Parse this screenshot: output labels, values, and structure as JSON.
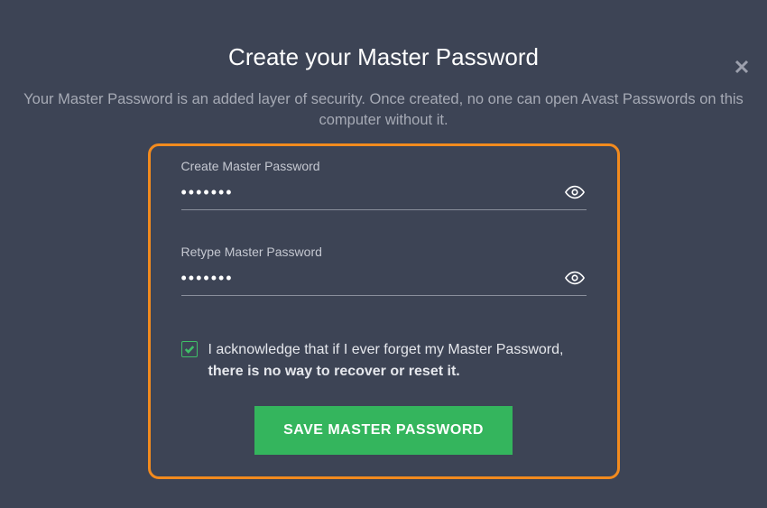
{
  "title": "Create your Master Password",
  "subtitle": "Your Master Password is an added layer of security. Once created, no one can open Avast Passwords on this computer without it.",
  "fields": {
    "create": {
      "label": "Create Master Password",
      "value": "•••••••"
    },
    "retype": {
      "label": "Retype Master Password",
      "value": "•••••••"
    }
  },
  "ack": {
    "checked": true,
    "text_prefix": "I acknowledge that if I ever forget my Master Password, ",
    "text_bold": "there is no way to recover or reset it."
  },
  "save_label": "SAVE MASTER PASSWORD"
}
